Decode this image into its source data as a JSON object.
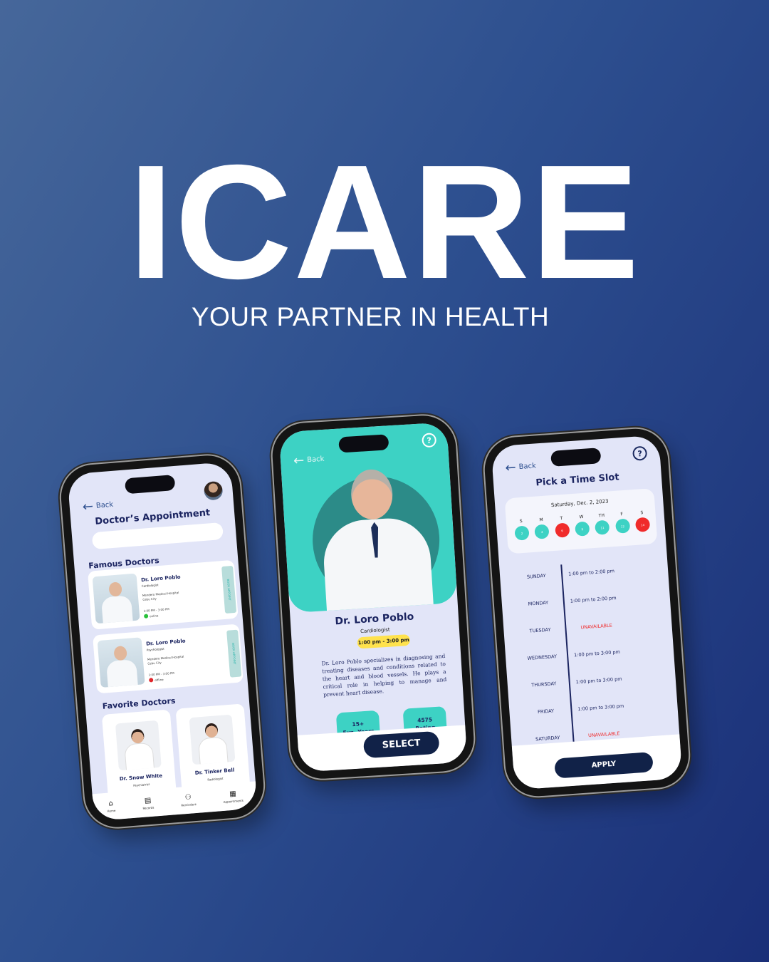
{
  "hero": {
    "title": "ICARE",
    "subtitle": "YOUR PARTNER IN HEALTH"
  },
  "colors": {
    "teal": "#3dd2c4",
    "navy": "#112248",
    "red": "#f02b2b",
    "yellow": "#ffe24d",
    "screen_bg": "#e2e5f8"
  },
  "phone1": {
    "back_label": "Back",
    "title": "Doctor’s Appointment",
    "search": {
      "value": "",
      "placeholder": ""
    },
    "famous_label": "Famous Doctors",
    "famous": [
      {
        "name": "Dr. Loro Poblo",
        "specialty": "Cardiologist",
        "hospital": "Mendero Medical Hospital",
        "city": "Cebu City",
        "time": "1:00 PM - 3:00 PM",
        "status": "online",
        "status_color": "#29c13b",
        "book_label": "BOOK APPOINT"
      },
      {
        "name": "Dr. Loro Poblo",
        "specialty": "Psychologist",
        "hospital": "Mendero Medical Hospital",
        "city": "Cebu City",
        "time": "1:00 PM - 3:00 PM",
        "status": "offline",
        "status_color": "#e0262b",
        "book_label": "BOOK APPOINT"
      }
    ],
    "favorite_label": "Favorite Doctors",
    "favorites": [
      {
        "name": "Dr. Snow White",
        "specialty": "Psychiatrist"
      },
      {
        "name": "Dr. Tinker Bell",
        "specialty": "Radiologist"
      }
    ],
    "nav": [
      {
        "label": "Home",
        "icon": "home-icon"
      },
      {
        "label": "Records",
        "icon": "records-icon"
      },
      {
        "label": "Reminders",
        "icon": "reminders-icon"
      },
      {
        "label": "Appointments",
        "icon": "calendar-icon"
      }
    ]
  },
  "phone2": {
    "back_label": "Back",
    "help": "?",
    "name": "Dr. Loro Poblo",
    "specialty": "Cardiologist",
    "time": "1:00 pm - 3:00 pm",
    "bio": "Dr. Loro Poblo specializes in diagnosing and treating diseases and conditions related to the heart and blood vessels. He plays a critical role in helping to manage and prevent heart disease.",
    "stats": [
      {
        "value": "15+",
        "label": "Exp. Years"
      },
      {
        "value": "4575",
        "label": "Rating"
      }
    ],
    "select_label": "SELECT"
  },
  "phone3": {
    "back_label": "Back",
    "help": "?",
    "title": "Pick a Time Slot",
    "date": "Saturday, Dec. 2, 2023",
    "days": [
      {
        "letter": "S",
        "num": "2",
        "available": true
      },
      {
        "letter": "M",
        "num": "4",
        "available": true
      },
      {
        "letter": "T",
        "num": "6",
        "available": false
      },
      {
        "letter": "W",
        "num": "9",
        "available": true
      },
      {
        "letter": "TH",
        "num": "11",
        "available": true
      },
      {
        "letter": "F",
        "num": "12",
        "available": true
      },
      {
        "letter": "S",
        "num": "14",
        "available": false
      }
    ],
    "schedule": [
      {
        "day": "SUNDAY",
        "slot": "1:00 pm to 2:00 pm",
        "available": true
      },
      {
        "day": "MONDAY",
        "slot": "1:00 pm to 2:00 pm",
        "available": true
      },
      {
        "day": "TUESDAY",
        "slot": "UNAVAILABLE",
        "available": false
      },
      {
        "day": "WEDNESDAY",
        "slot": "1:00 pm to 3:00 pm",
        "available": true
      },
      {
        "day": "THURSDAY",
        "slot": "1:00 pm to 3:00 pm",
        "available": true
      },
      {
        "day": "FRIDAY",
        "slot": "1:00 pm to 3:00 pm",
        "available": true
      },
      {
        "day": "SATURDAY",
        "slot": "UNAVAILABLE",
        "available": false
      }
    ],
    "apply_label": "APPLY"
  }
}
